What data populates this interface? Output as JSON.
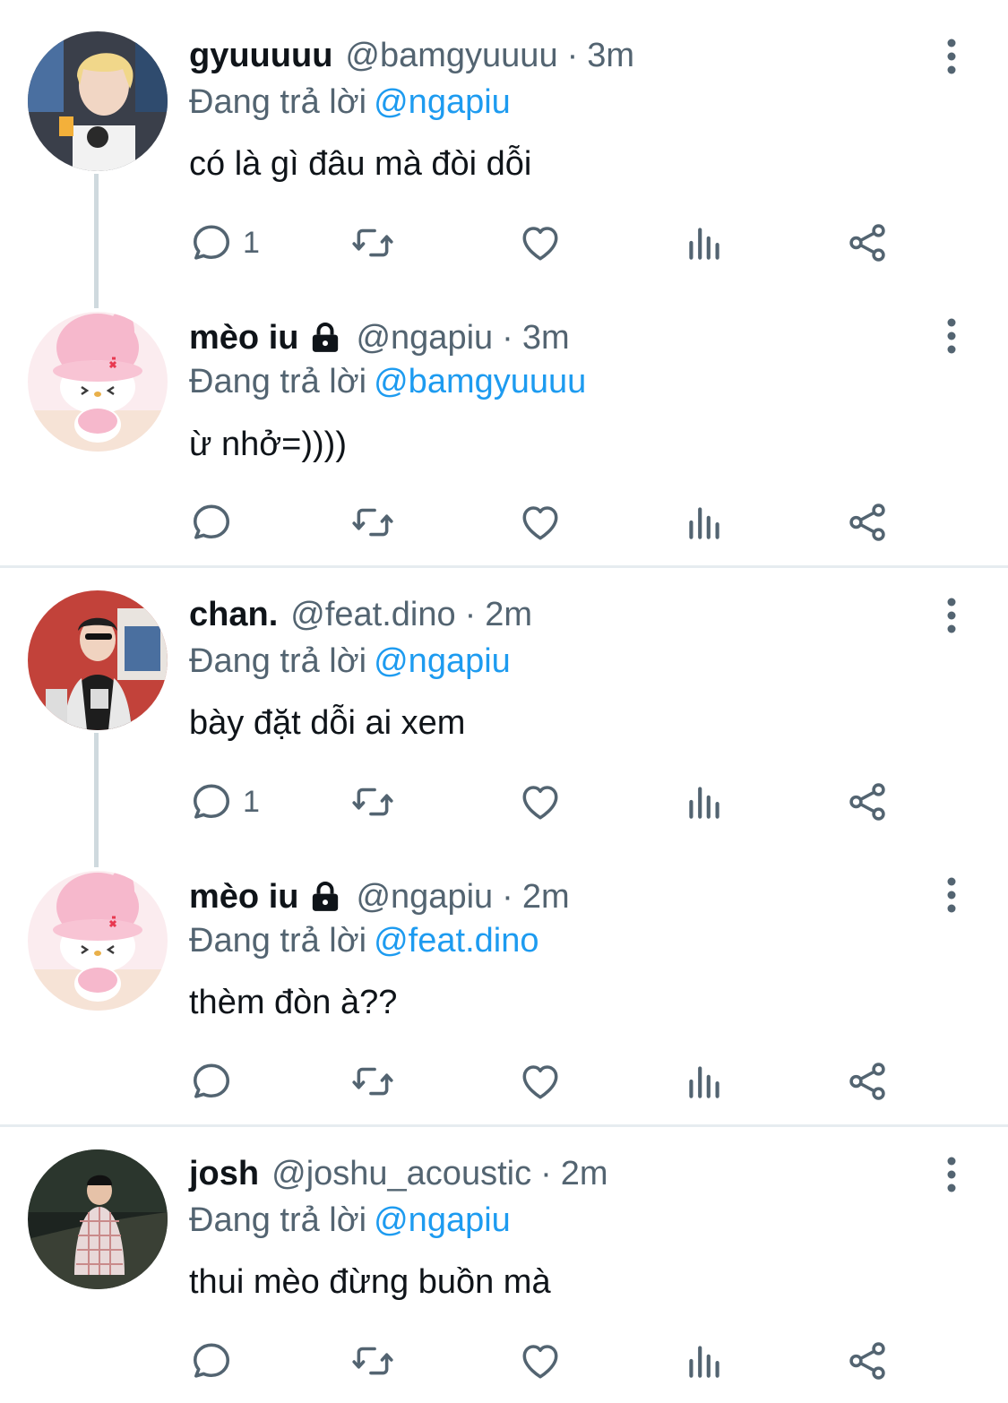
{
  "reply_prefix": "Đang trả lời",
  "tweets": [
    {
      "display_name": "gyuuuuu",
      "locked": false,
      "handle": "@bamgyuuuu",
      "separator": "·",
      "time": "3m",
      "reply_to": "@ngapiu",
      "text": "có là gì đâu mà đòi dỗi",
      "reply_count": "1",
      "avatar": "photo-blond-person"
    },
    {
      "display_name": "mèo iu",
      "locked": true,
      "handle": "@ngapiu",
      "separator": "·",
      "time": "3m",
      "reply_to": "@bamgyuuuu",
      "text": "ừ nhở=))))",
      "reply_count": "",
      "avatar": "pink-bunny-character"
    },
    {
      "display_name": "chan.",
      "locked": false,
      "handle": "@feat.dino",
      "separator": "·",
      "time": "2m",
      "reply_to": "@ngapiu",
      "text": "bày đặt dỗi ai xem",
      "reply_count": "1",
      "avatar": "photo-person-varsity-jacket"
    },
    {
      "display_name": "mèo iu",
      "locked": true,
      "handle": "@ngapiu",
      "separator": "·",
      "time": "2m",
      "reply_to": "@feat.dino",
      "text": "thèm đòn à??",
      "reply_count": "",
      "avatar": "pink-bunny-character"
    },
    {
      "display_name": "josh",
      "locked": false,
      "handle": "@joshu_acoustic",
      "separator": "·",
      "time": "2m",
      "reply_to": "@ngapiu",
      "text": "thui mèo đừng buồn mà",
      "reply_count": "",
      "avatar": "photo-person-plaid-shirt"
    }
  ],
  "colors": {
    "text": "#0f1419",
    "secondary": "#536471",
    "link": "#1d9bf0",
    "thread_line": "#cfd9de",
    "divider": "#e6ecf0"
  },
  "icons": [
    "reply-icon",
    "retweet-icon",
    "like-icon",
    "views-icon",
    "share-icon",
    "more-icon",
    "lock-icon"
  ]
}
